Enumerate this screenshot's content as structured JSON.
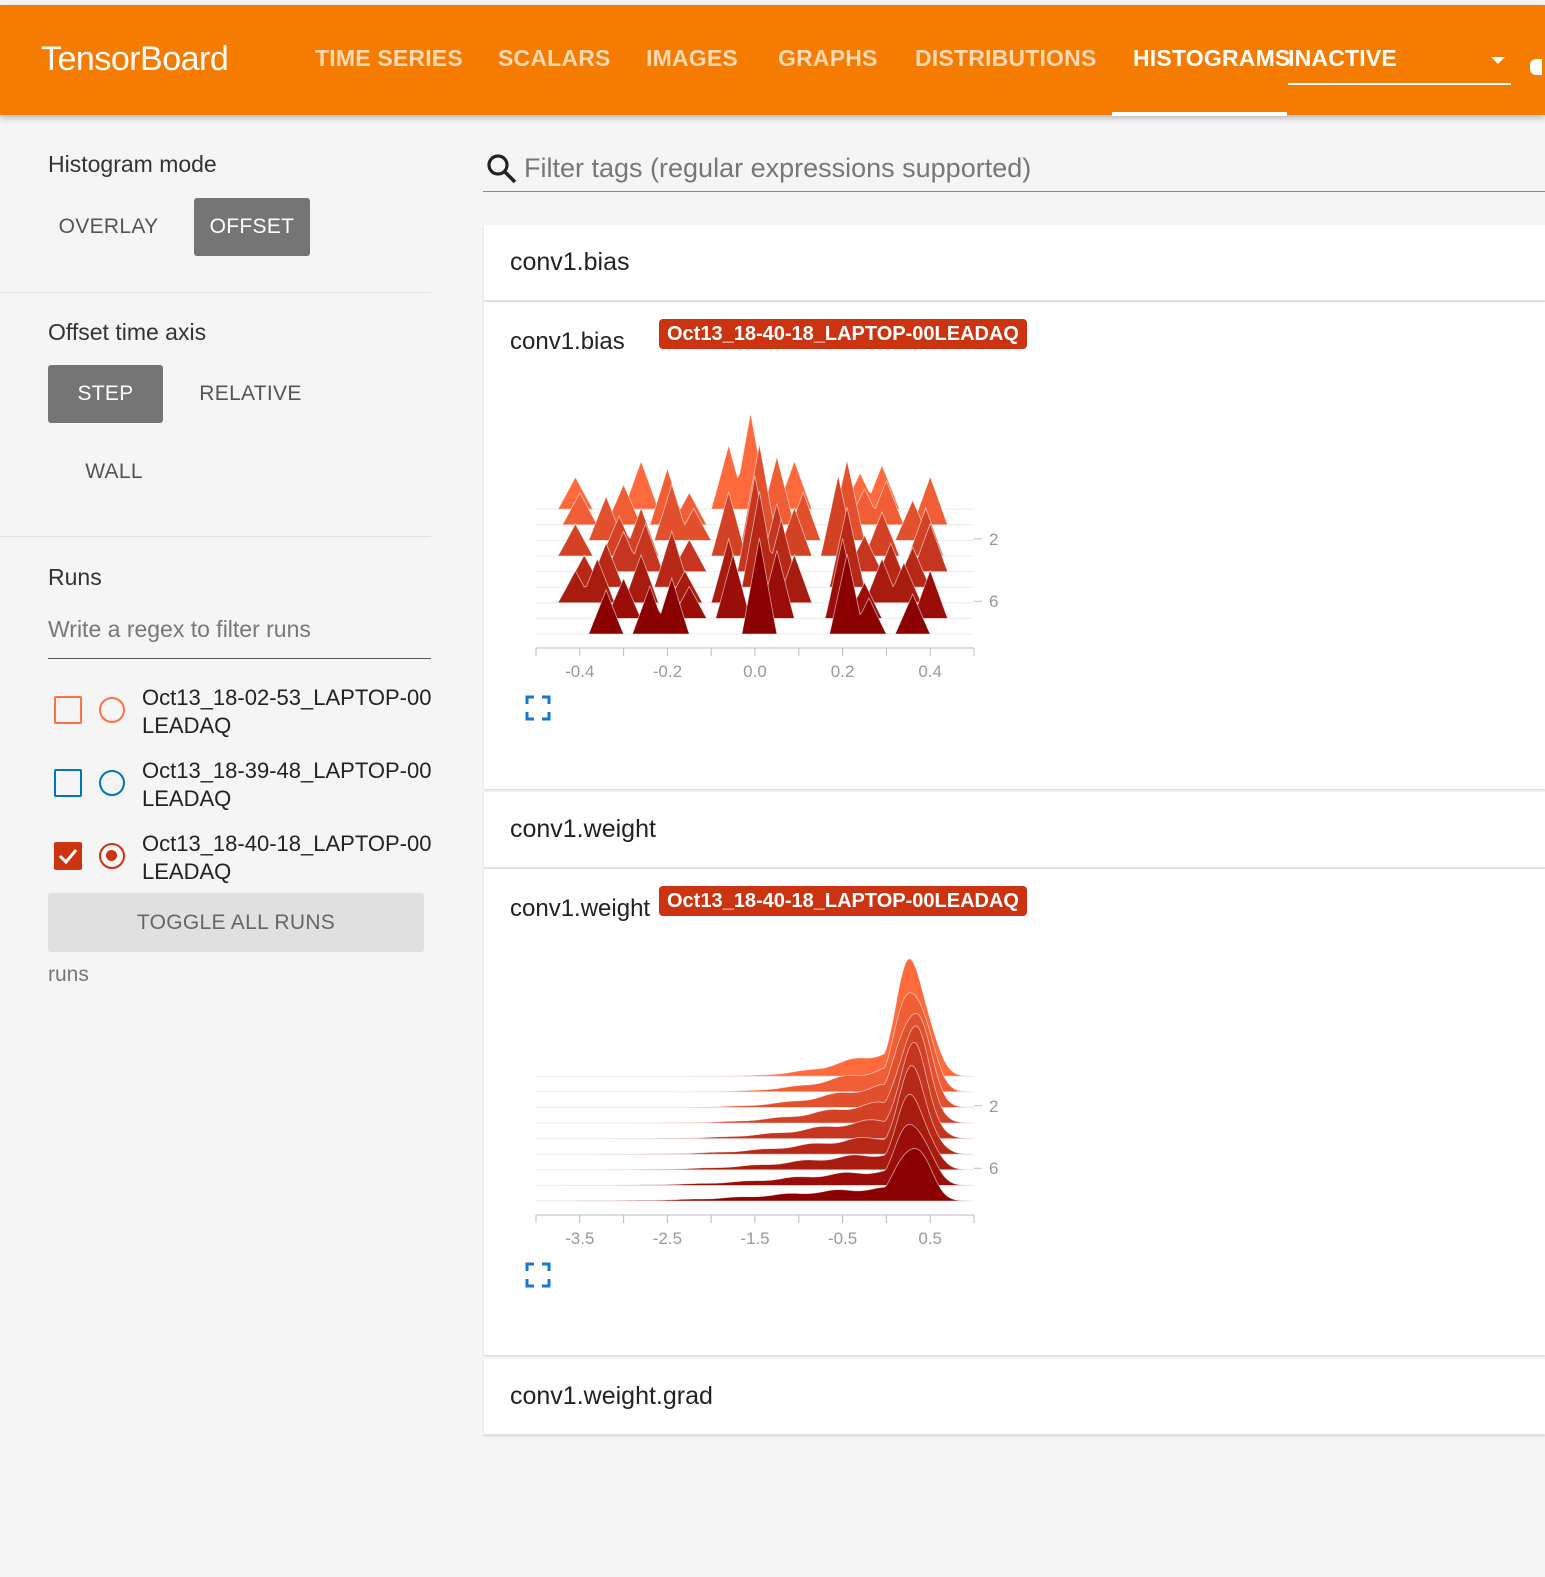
{
  "header": {
    "brand": "TensorBoard",
    "tabs": [
      {
        "label": "TIME SERIES",
        "active": false
      },
      {
        "label": "SCALARS",
        "active": false
      },
      {
        "label": "IMAGES",
        "active": false
      },
      {
        "label": "GRAPHS",
        "active": false
      },
      {
        "label": "DISTRIBUTIONS",
        "active": false
      },
      {
        "label": "HISTOGRAMS",
        "active": true
      }
    ],
    "inactive_label": "INACTIVE",
    "accent_color": "#f57c00"
  },
  "sidebar": {
    "histogram_mode": {
      "title": "Histogram mode",
      "options": [
        "OVERLAY",
        "OFFSET"
      ],
      "selected": "OFFSET"
    },
    "offset_time_axis": {
      "title": "Offset time axis",
      "options": [
        "STEP",
        "RELATIVE",
        "WALL"
      ],
      "selected": "STEP"
    },
    "runs": {
      "title": "Runs",
      "filter_placeholder": "Write a regex to filter runs",
      "items": [
        {
          "label": "Oct13_18-02-53_LAPTOP-00LEADAQ",
          "color": "#ff7043",
          "checked": false,
          "selected": false
        },
        {
          "label": "Oct13_18-39-48_LAPTOP-00LEADAQ",
          "color": "#0077bb",
          "checked": false,
          "selected": false
        },
        {
          "label": "Oct13_18-40-18_LAPTOP-00LEADAQ",
          "color": "#cc3311",
          "checked": true,
          "selected": true
        }
      ],
      "toggle_all_label": "TOGGLE ALL RUNS",
      "footer": "runs"
    }
  },
  "main": {
    "search_placeholder": "Filter tags (regular expressions supported)",
    "cards": [
      {
        "tag": "conv1.bias",
        "chart_title": "conv1.bias",
        "run_tag": "Oct13_18-40-18_LAPTOP-00LEADAQ"
      },
      {
        "tag": "conv1.weight",
        "chart_title": "conv1.weight",
        "run_tag": "Oct13_18-40-18_LAPTOP-00LEADAQ"
      },
      {
        "tag": "conv1.weight.grad"
      }
    ]
  },
  "chart_data": [
    {
      "type": "area",
      "title": "conv1.bias",
      "mode": "offset",
      "x_ticks": [
        "-0.4",
        "-0.2",
        "0.0",
        "0.2",
        "0.4"
      ],
      "xlim": [
        -0.5,
        0.5
      ],
      "step_ticks": [
        "2",
        "6"
      ],
      "steps": [
        0,
        1,
        2,
        3,
        4,
        5,
        6,
        7,
        8
      ],
      "peaks": [
        [
          -0.4,
          0.8
        ],
        [
          -0.35,
          1.1
        ],
        [
          -0.3,
          1.0
        ],
        [
          -0.25,
          1.2
        ],
        [
          -0.2,
          1.4
        ],
        [
          -0.15,
          0.8
        ],
        [
          -0.05,
          1.6
        ],
        [
          0.0,
          2.4
        ],
        [
          0.05,
          1.7
        ],
        [
          0.1,
          1.2
        ],
        [
          0.2,
          2.0
        ],
        [
          0.25,
          0.9
        ],
        [
          0.3,
          1.1
        ],
        [
          0.35,
          1.0
        ],
        [
          0.4,
          1.2
        ]
      ],
      "color_start": "#ff6a3d",
      "color_end": "#8b0000"
    },
    {
      "type": "area",
      "title": "conv1.weight",
      "mode": "offset",
      "x_ticks": [
        "-3.5",
        "-2.5",
        "-1.5",
        "-0.5",
        "0.5"
      ],
      "xlim": [
        -4.0,
        1.0
      ],
      "step_ticks": [
        "2",
        "6"
      ],
      "steps": [
        0,
        1,
        2,
        3,
        4,
        5,
        6,
        7,
        8
      ],
      "center": 0.3,
      "color_start": "#ff6a3d",
      "color_end": "#8b0000"
    }
  ]
}
